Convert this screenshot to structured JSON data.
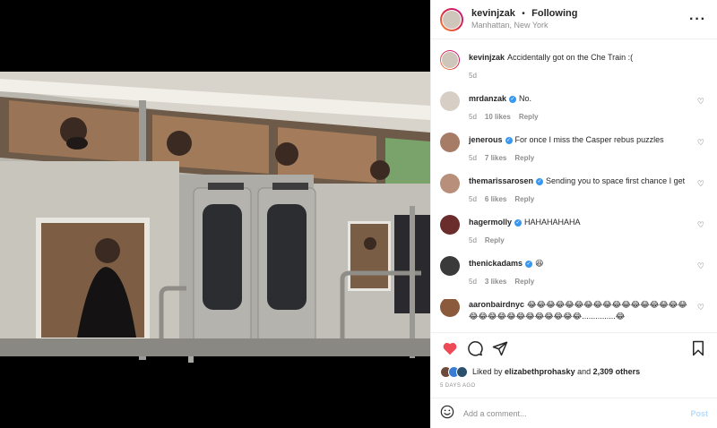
{
  "post": {
    "username": "kevinjzak",
    "separator": "•",
    "follow_status": "Following",
    "location": "Manhattan, New York",
    "more_icon": "ellipsis-icon"
  },
  "caption": {
    "username": "kevinjzak",
    "text": "Accidentally got on the Che Train :(",
    "time": "5d"
  },
  "comments": [
    {
      "username": "mrdanzak",
      "verified": true,
      "text": "No.",
      "time": "5d",
      "likes": "10 likes",
      "reply": "Reply",
      "avatar_color": "#d7cfc6"
    },
    {
      "username": "jenerous",
      "verified": true,
      "text": "For once I miss the Casper rebus puzzles",
      "time": "5d",
      "likes": "7 likes",
      "reply": "Reply",
      "avatar_color": "#a67c66"
    },
    {
      "username": "themarissarosen",
      "verified": true,
      "text": "Sending you to space first chance I get",
      "time": "5d",
      "likes": "6 likes",
      "reply": "Reply",
      "avatar_color": "#b88f7a"
    },
    {
      "username": "hagermolly",
      "verified": true,
      "text": "HAHAHAHAHA",
      "time": "5d",
      "likes": "",
      "reply": "Reply",
      "avatar_color": "#6b2c2c"
    },
    {
      "username": "thenickadams",
      "verified": true,
      "text": "😆",
      "time": "5d",
      "likes": "3 likes",
      "reply": "Reply",
      "avatar_color": "#3a3a3a"
    },
    {
      "username": "aaronbairdnyc",
      "verified": false,
      "text": "😂😂😂😂😂😂😂😂😂😂😂😂😂😂😂😂😂😂😂😂😂😂😂😂😂😂😂😂😂...............😂",
      "time": "",
      "likes": "",
      "reply": "",
      "avatar_color": "#8b5a3c"
    }
  ],
  "actions": {
    "like_icon": "heart-filled-icon",
    "comment_icon": "comment-icon",
    "share_icon": "paper-plane-icon",
    "save_icon": "bookmark-icon"
  },
  "likes": {
    "prefix": "Liked by",
    "user": "elizabethprohasky",
    "and": "and",
    "count": "2,309 others"
  },
  "date": "5 DAYS AGO",
  "add_comment": {
    "placeholder": "Add a comment...",
    "post_label": "Post",
    "emoji_icon": "smiley-icon"
  },
  "colors": {
    "accent": "#3897f0",
    "heart": "#ed4956",
    "post_disabled": "#b3dbff"
  }
}
